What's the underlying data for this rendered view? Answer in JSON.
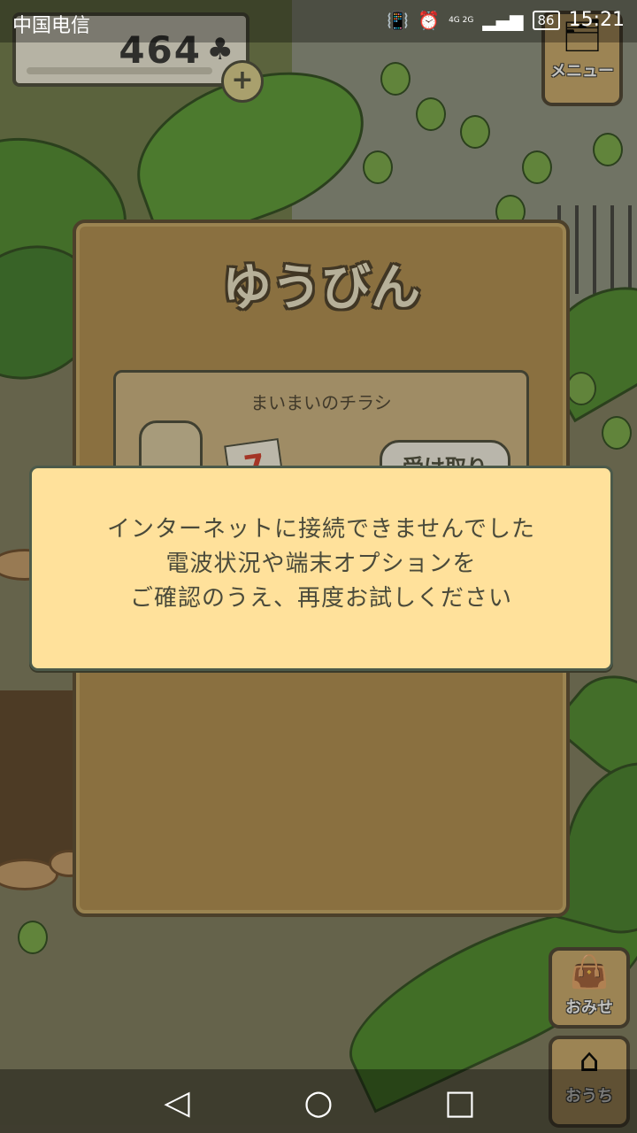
{
  "status_bar": {
    "carrier": "中国电信",
    "network": "4G 2G",
    "battery": "86",
    "time": "15:21"
  },
  "hud": {
    "clover_count": "464",
    "menu_label": "メニュー",
    "shop_label": "おみせ",
    "home_label": "おうち"
  },
  "mail": {
    "title": "ゆうびん",
    "item_title": "まいまいのチラシ",
    "receive_label": "受け取り"
  },
  "error_dialog": {
    "lines": [
      "インターネットに接続できませんでした",
      "電波状況や端末オプションを",
      "ご確認のうえ、再度お試しください"
    ]
  },
  "icons": {
    "clover": "clover-icon",
    "vibrate": "vibrate-icon",
    "alarm": "alarm-icon",
    "back": "back-icon",
    "home": "home-circle-icon",
    "recent": "recent-apps-icon"
  }
}
